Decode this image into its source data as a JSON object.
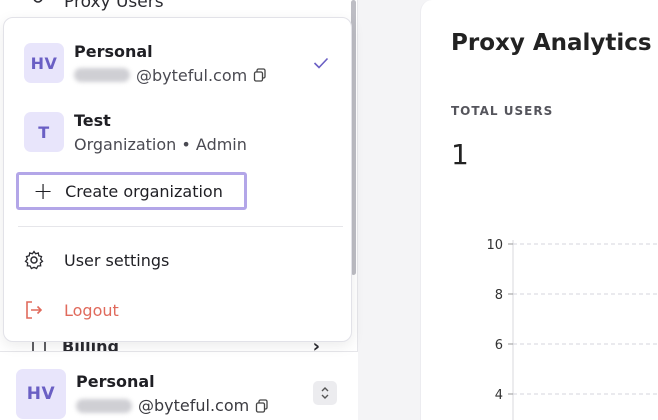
{
  "sidebar": {
    "nav_peek_label": "Proxy Users",
    "billing_label": "Billing",
    "billing_chevron": "›"
  },
  "footer_account": {
    "initials": "HV",
    "name": "Personal",
    "email_suffix": "@byteful.com"
  },
  "dropdown": {
    "accounts": [
      {
        "initials": "HV",
        "name": "Personal",
        "subtitle": "@byteful.com",
        "selected": true
      },
      {
        "initials": "T",
        "name": "Test",
        "subtitle": "Organization • Admin",
        "selected": false
      }
    ],
    "create_label": "Create organization",
    "user_settings_label": "User settings",
    "logout_label": "Logout"
  },
  "main": {
    "title": "Proxy Analytics",
    "stat_label": "TOTAL USERS",
    "stat_value": "1"
  },
  "colors": {
    "accent": "#6a5fc4",
    "highlight_border": "#b3a6e8",
    "logout": "#e06a5c"
  },
  "chart_data": {
    "type": "line",
    "y_ticks": [
      "10",
      "8",
      "6",
      "4"
    ],
    "ylim": [
      4,
      10
    ],
    "grid": true,
    "series": []
  }
}
